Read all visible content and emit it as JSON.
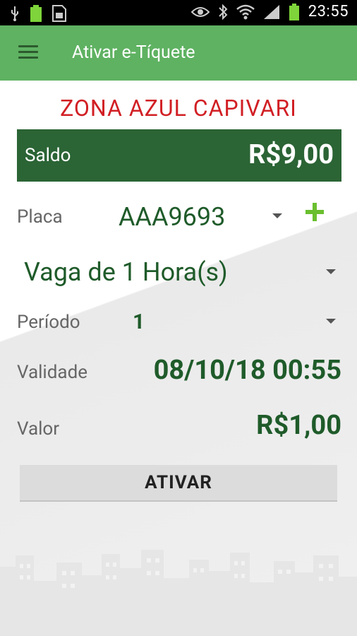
{
  "status_bar": {
    "time": "23:55",
    "left_icons": [
      "usb-icon",
      "battery-full-icon",
      "sim-card-icon"
    ],
    "right_icons": [
      "eye-icon",
      "bluetooth-icon",
      "wifi-icon",
      "signal-icon",
      "battery-icon"
    ]
  },
  "app_bar": {
    "title": "Ativar e-Tíquete",
    "menu_icon": "hamburger-menu-icon",
    "background": "#5fb262"
  },
  "zone": {
    "title": "ZONA AZUL CAPIVARI",
    "color": "#d11f24"
  },
  "balance": {
    "label": "Saldo",
    "value": "R$9,00",
    "background": "#2b6435"
  },
  "plate": {
    "label": "Placa",
    "selected": "AAA9693",
    "add_icon": "plus-icon"
  },
  "parking": {
    "selected": "Vaga de 1 Hora(s)"
  },
  "period": {
    "label": "Período",
    "selected": "1"
  },
  "validity": {
    "label": "Validade",
    "value": "08/10/18 00:55"
  },
  "amount": {
    "label": "Valor",
    "value": "R$1,00"
  },
  "actions": {
    "activate_label": "ATIVAR"
  },
  "colors": {
    "accent_green": "#1f5b2a",
    "add_green": "#6abf2e"
  }
}
